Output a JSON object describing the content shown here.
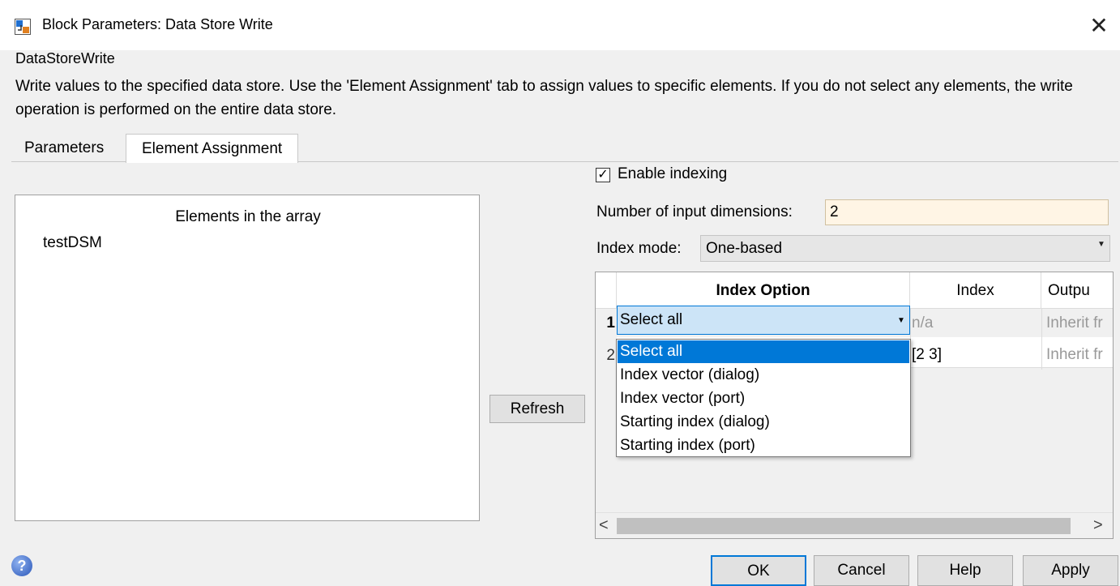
{
  "window": {
    "title": "Block Parameters: Data Store Write",
    "close_glyph": "✕"
  },
  "block": {
    "type": "DataStoreWrite",
    "description": "Write values to the specified data store. Use the 'Element Assignment' tab to assign values to specific elements. If you do not select any elements, the write operation is performed on the entire data store."
  },
  "tabs": [
    {
      "label": "Parameters"
    },
    {
      "label": "Element Assignment",
      "active": true
    }
  ],
  "elements_tree": {
    "header": "Elements in the array",
    "items": [
      "testDSM"
    ]
  },
  "refresh_label": "Refresh",
  "enable_indexing": {
    "label": "Enable indexing",
    "checked": true,
    "check_glyph": "✓"
  },
  "input_dimensions": {
    "label": "Number of input dimensions:",
    "value": "2"
  },
  "index_mode": {
    "label": "Index mode:",
    "value": "One-based",
    "arrow": "▼"
  },
  "table": {
    "columns": [
      "Index Option",
      "Index",
      "Outpu"
    ],
    "rows": [
      {
        "num": "1",
        "option": "Select all",
        "index": "n/a",
        "output": "Inherit fr"
      },
      {
        "num": "2",
        "option": "",
        "index": "[2 3]",
        "output": "Inherit fr"
      }
    ],
    "scroll_left": "<",
    "scroll_right": ">",
    "option_arrow": "▼"
  },
  "dropdown_options": [
    "Select all",
    "Index vector (dialog)",
    "Index vector (port)",
    "Starting index (dialog)",
    "Starting index (port)"
  ],
  "footer": {
    "help_icon_glyph": "?",
    "ok": "OK",
    "cancel": "Cancel",
    "help": "Help",
    "apply": "Apply"
  },
  "colors": {
    "accent": "#0078d7",
    "selected_cell": "#cce4f7",
    "input_bg": "#fff5e5"
  }
}
